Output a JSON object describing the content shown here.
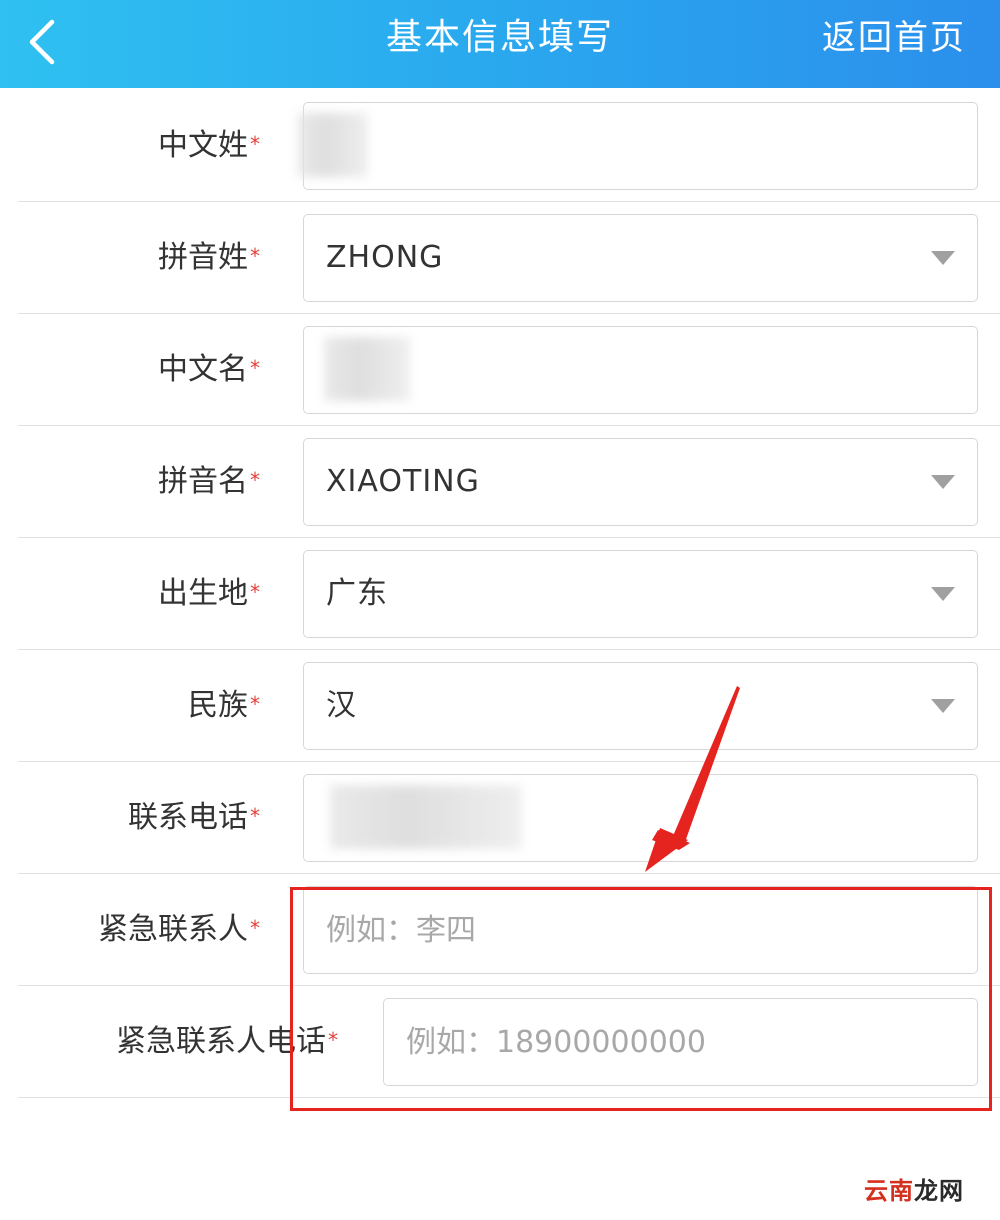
{
  "header": {
    "title": "基本信息填写",
    "home_link": "返回首页"
  },
  "required_mark": "*",
  "form": {
    "rows": [
      {
        "label": "中文姓",
        "value": "",
        "type": "text",
        "redacted": true
      },
      {
        "label": "拼音姓",
        "value": "ZHONG",
        "type": "select"
      },
      {
        "label": "中文名",
        "value": "",
        "type": "text",
        "redacted": true
      },
      {
        "label": "拼音名",
        "value": "XIAOTING",
        "type": "select"
      },
      {
        "label": "出生地",
        "value": "广东",
        "type": "select"
      },
      {
        "label": "民族",
        "value": "汉",
        "type": "select"
      },
      {
        "label": "联系电话",
        "value": "",
        "type": "text",
        "redacted": true
      },
      {
        "label": "紧急联系人",
        "placeholder": "例如：李四",
        "type": "input"
      },
      {
        "label": "紧急联系人电话",
        "placeholder": "例如：18900000000",
        "type": "input"
      }
    ]
  },
  "watermark": {
    "part1": "云南",
    "part2": "龙网"
  },
  "colors": {
    "header_start": "#2fc1f1",
    "header_end": "#2b8fec",
    "required": "#e0403b",
    "annotation": "#e5231f"
  },
  "icons": {
    "back": "chevron-left-icon",
    "dropdown": "caret-down-icon"
  }
}
